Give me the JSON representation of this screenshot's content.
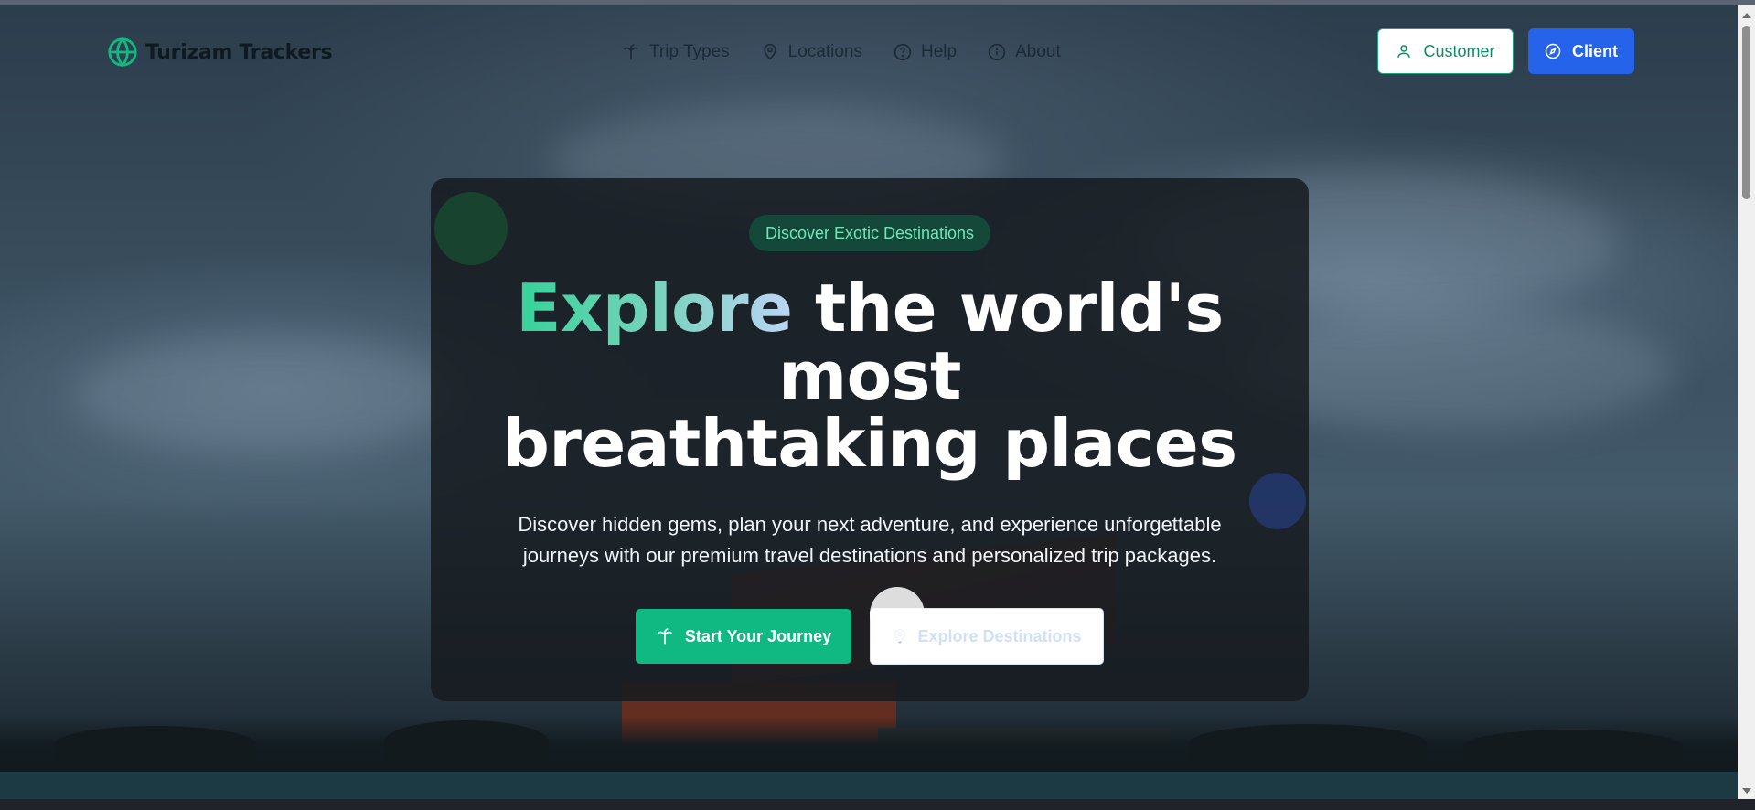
{
  "brand": {
    "name": "Turizam Trackers"
  },
  "nav": {
    "links": [
      {
        "label": "Trip Types",
        "icon": "palm-tree-icon"
      },
      {
        "label": "Locations",
        "icon": "map-pin-icon"
      },
      {
        "label": "Help",
        "icon": "help-circle-icon"
      },
      {
        "label": "About",
        "icon": "info-circle-icon"
      }
    ],
    "customer_label": "Customer",
    "client_label": "Client"
  },
  "hero": {
    "badge": "Discover Exotic Destinations",
    "headline_accent": "Explore",
    "headline_rest": " the world's most",
    "headline_line2": "breathtaking places",
    "subtext": "Discover hidden gems, plan your next adventure, and experience unforgettable journeys with our premium travel destinations and personalized trip packages.",
    "primary_cta": "Start Your Journey",
    "secondary_cta": "Explore Destinations"
  },
  "colors": {
    "brand_green": "#10b981",
    "client_blue": "#2563eb",
    "badge_bg": "#14493a"
  }
}
